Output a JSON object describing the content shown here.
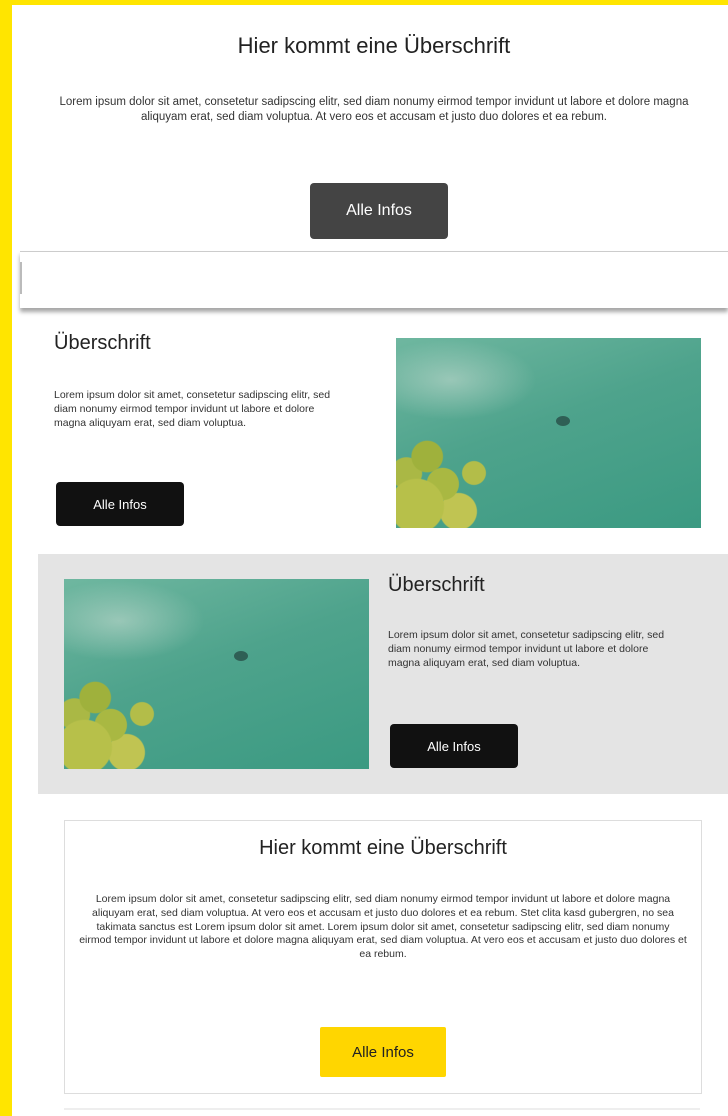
{
  "hero": {
    "title": "Hier kommt eine Überschrift",
    "text": "Lorem ipsum dolor sit amet, consetetur sadipscing elitr, sed diam nonumy eirmod tempor invidunt ut labore et dolore magna aliquyam erat, sed diam voluptua. At vero eos et accusam et justo duo dolores et ea rebum.",
    "button_label": "Alle Infos"
  },
  "feature_1": {
    "title": "Überschrift",
    "text": "Lorem ipsum dolor sit amet, consetetur sadipscing elitr, sed diam nonumy eirmod tempor invidunt ut labore et dolore magna aliquyam erat, sed diam voluptua.",
    "button_label": "Alle Infos"
  },
  "feature_2": {
    "title": "Überschrift",
    "text": "Lorem ipsum dolor sit amet, consetetur sadipscing elitr, sed diam nonumy eirmod tempor invidunt ut labore et dolore magna aliquyam erat, sed diam voluptua.",
    "button_label": "Alle Infos"
  },
  "info_card": {
    "title": "Hier kommt eine Überschrift",
    "text": "Lorem ipsum dolor sit amet, consetetur sadipscing elitr, sed diam nonumy eirmod tempor invidunt ut labore et dolore magna aliquyam erat, sed diam voluptua. At vero eos et accusam et justo duo dolores et ea rebum. Stet clita kasd gubergren, no sea takimata sanctus est Lorem ipsum dolor sit amet. Lorem ipsum dolor sit amet, consetetur sadipscing elitr, sed diam nonumy eirmod tempor invidunt ut labore et dolore magna aliquyam erat, sed diam voluptua. At vero eos et accusam et justo duo dolores et ea rebum.",
    "button_label": "Alle Infos"
  },
  "colors": {
    "accent_yellow": "#ffe500",
    "button_dark": "#444444",
    "button_black": "#111111",
    "section_gray": "#e4e4e4",
    "button_yellow": "#ffd600"
  }
}
